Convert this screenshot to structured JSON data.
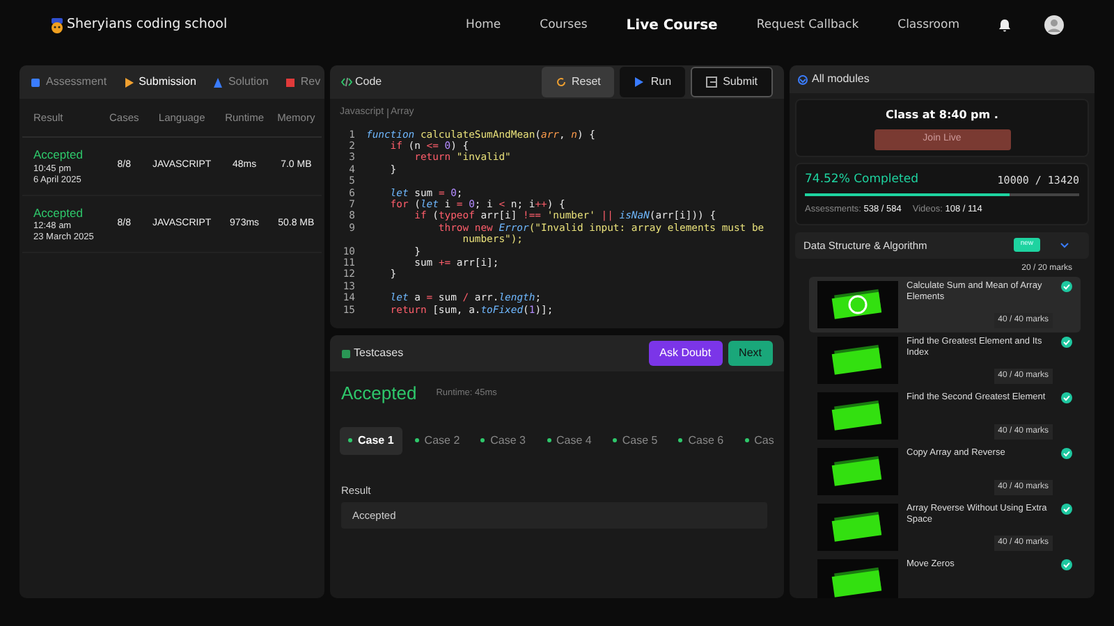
{
  "navbar": {
    "brand": "Sheryians coding school",
    "links": [
      {
        "label": "Home",
        "selected": false
      },
      {
        "label": "Courses",
        "selected": false
      },
      {
        "label": "Live Course",
        "selected": true
      },
      {
        "label": "Request Callback",
        "selected": false
      },
      {
        "label": "Classroom",
        "selected": false
      }
    ]
  },
  "left_panel": {
    "tabs": [
      {
        "label": "Assessment",
        "kind": "assessment",
        "selected": false
      },
      {
        "label": "Submission",
        "kind": "submission",
        "selected": true
      },
      {
        "label": "Solution",
        "kind": "solution",
        "selected": false
      },
      {
        "label": "Rev",
        "kind": "review",
        "selected": false
      }
    ],
    "table": {
      "columns": [
        "Result",
        "Cases",
        "Language",
        "Runtime",
        "Memory"
      ],
      "rows": [
        {
          "result": "Accepted",
          "time": "10:45 pm",
          "date": "6 April 2025",
          "cases": "8/8",
          "language": "JAVASCRIPT",
          "runtime": "48ms",
          "memory": "7.0 MB"
        },
        {
          "result": "Accepted",
          "time": "12:48 am",
          "date": "23 March 2025",
          "cases": "8/8",
          "language": "JAVASCRIPT",
          "runtime": "973ms",
          "memory": "50.8 MB"
        }
      ]
    }
  },
  "code_panel": {
    "title": "Code",
    "buttons": [
      {
        "label": "Reset",
        "kind": "reset"
      },
      {
        "label": "Run",
        "kind": "run"
      },
      {
        "label": "Submit",
        "kind": "submit"
      }
    ],
    "language": "Javascript",
    "topic": "Array",
    "lines": [
      {
        "number": "1",
        "tokens": [
          {
            "kind": "decl",
            "text": "function"
          },
          {
            "kind": "fn",
            "text": " calculateSumAndMean"
          },
          {
            "kind": "plain",
            "text": "("
          },
          {
            "kind": "param",
            "text": "arr"
          },
          {
            "kind": "plain",
            "text": ", "
          },
          {
            "kind": "param",
            "text": "n"
          },
          {
            "kind": "plain",
            "text": ") {"
          }
        ]
      },
      {
        "number": "2",
        "tokens": [
          {
            "kind": "kw",
            "text": "    if"
          },
          {
            "kind": "plain",
            "text": " (n "
          },
          {
            "kind": "op",
            "text": "<="
          },
          {
            "kind": "num",
            "text": " 0"
          },
          {
            "kind": "plain",
            "text": ") {"
          }
        ]
      },
      {
        "number": "3",
        "tokens": [
          {
            "kind": "kw",
            "text": "        return"
          },
          {
            "kind": "str",
            "text": " \"invalid\""
          }
        ]
      },
      {
        "number": "4",
        "tokens": [
          {
            "kind": "plain",
            "text": "    }"
          }
        ]
      },
      {
        "number": "5"
      },
      {
        "number": "6",
        "tokens": [
          {
            "kind": "decl",
            "text": "    let"
          },
          {
            "kind": "plain",
            "text": " sum "
          },
          {
            "kind": "op",
            "text": "="
          },
          {
            "kind": "num",
            "text": " 0"
          },
          {
            "kind": "plain",
            "text": ";"
          }
        ]
      },
      {
        "number": "7",
        "tokens": [
          {
            "kind": "kw",
            "text": "    for"
          },
          {
            "kind": "plain",
            "text": " ("
          },
          {
            "kind": "decl",
            "text": "let"
          },
          {
            "kind": "plain",
            "text": " i "
          },
          {
            "kind": "op",
            "text": "="
          },
          {
            "kind": "num",
            "text": " 0"
          },
          {
            "kind": "plain",
            "text": "; i "
          },
          {
            "kind": "op",
            "text": "<"
          },
          {
            "kind": "plain",
            "text": " n; i"
          },
          {
            "kind": "op",
            "text": "++"
          },
          {
            "kind": "plain",
            "text": ") {"
          }
        ]
      },
      {
        "number": "8",
        "tokens": [
          {
            "kind": "kw",
            "text": "        if"
          },
          {
            "kind": "plain",
            "text": " ("
          },
          {
            "kind": "kw",
            "text": "typeof"
          },
          {
            "kind": "plain",
            "text": " arr[i] "
          },
          {
            "kind": "op",
            "text": "!=="
          },
          {
            "kind": "str",
            "text": " 'number' "
          },
          {
            "kind": "op",
            "text": "||"
          },
          {
            "kind": "decl",
            "text": " isNaN"
          },
          {
            "kind": "plain",
            "text": "(arr[i])) {"
          }
        ]
      },
      {
        "number": "9",
        "tokens": [
          {
            "kind": "kw",
            "text": "            throw new"
          },
          {
            "kind": "decl",
            "text": " Error"
          },
          {
            "kind": "str",
            "text": "(\"Invalid input: array elements must be"
          }
        ]
      },
      {
        "tokens": [
          {
            "kind": "str",
            "text": "                numbers\");"
          }
        ]
      },
      {
        "number": "10",
        "tokens": [
          {
            "kind": "plain",
            "text": "        }"
          }
        ]
      },
      {
        "number": "11",
        "tokens": [
          {
            "kind": "plain",
            "text": "        sum "
          },
          {
            "kind": "op",
            "text": "+="
          },
          {
            "kind": "plain",
            "text": " arr[i];"
          }
        ]
      },
      {
        "number": "12",
        "tokens": [
          {
            "kind": "plain",
            "text": "    }"
          }
        ]
      },
      {
        "number": "13"
      },
      {
        "number": "14",
        "tokens": [
          {
            "kind": "decl",
            "text": "    let"
          },
          {
            "kind": "plain",
            "text": " a "
          },
          {
            "kind": "op",
            "text": "="
          },
          {
            "kind": "plain",
            "text": " sum "
          },
          {
            "kind": "op",
            "text": "/"
          },
          {
            "kind": "plain",
            "text": " arr."
          },
          {
            "kind": "decl",
            "text": "length"
          },
          {
            "kind": "plain",
            "text": ";"
          }
        ]
      },
      {
        "number": "15",
        "tokens": [
          {
            "kind": "kw",
            "text": "    return"
          },
          {
            "kind": "plain",
            "text": " [sum, a."
          },
          {
            "kind": "decl",
            "text": "toFixed"
          },
          {
            "kind": "plain",
            "text": "("
          },
          {
            "kind": "num",
            "text": "1"
          },
          {
            "kind": "plain",
            "text": ")];"
          }
        ]
      }
    ]
  },
  "testcases_panel": {
    "title": "Testcases",
    "buttons": [
      {
        "label": "Ask Doubt",
        "kind": "doubt"
      },
      {
        "label": "Next",
        "kind": "next"
      }
    ],
    "status": "Accepted",
    "runtime": "Runtime: 45ms",
    "cases": [
      {
        "label": "Case 1",
        "selected": true,
        "passed": true
      },
      {
        "label": "Case 2",
        "selected": false,
        "passed": true
      },
      {
        "label": "Case 3",
        "selected": false,
        "passed": true
      },
      {
        "label": "Case 4",
        "selected": false,
        "passed": true
      },
      {
        "label": "Case 5",
        "selected": false,
        "passed": true
      },
      {
        "label": "Case 6",
        "selected": false,
        "passed": true
      },
      {
        "label": "Cas",
        "selected": false,
        "passed": true
      }
    ],
    "result_label": "Result",
    "result_value": "Accepted"
  },
  "modules_panel": {
    "title": "All modules",
    "class_text": "Class at 8:40 pm .",
    "join_button": "Join Live",
    "progress_text": "74.52% Completed",
    "progress_count": "10000 / 13420",
    "level": 0.7452,
    "stats": [
      {
        "label": "Assessments:",
        "value": "538 / 584"
      },
      {
        "label": "Videos:",
        "value": "108 / 114"
      }
    ],
    "module": {
      "title": "Data Structure & Algorithm",
      "badge": "new",
      "expanded": true,
      "previous_marks": "20 / 20 marks",
      "items": [
        {
          "title": "Calculate Sum and Mean of Array Elements",
          "marks": "40 / 40 marks",
          "completed": true,
          "selected": true
        },
        {
          "title": "Find the Greatest Element and Its Index",
          "marks": "40 / 40 marks",
          "completed": true,
          "selected": false
        },
        {
          "title": "Find the Second Greatest Element",
          "marks": "40 / 40 marks",
          "completed": true,
          "selected": false
        },
        {
          "title": "Copy Array and Reverse",
          "marks": "40 / 40 marks",
          "completed": true,
          "selected": false
        },
        {
          "title": "Array Reverse Without Using Extra Space",
          "marks": "40 / 40 marks",
          "completed": true,
          "selected": false
        },
        {
          "title": "Move Zeros",
          "completed": true,
          "selected": false
        }
      ]
    }
  }
}
